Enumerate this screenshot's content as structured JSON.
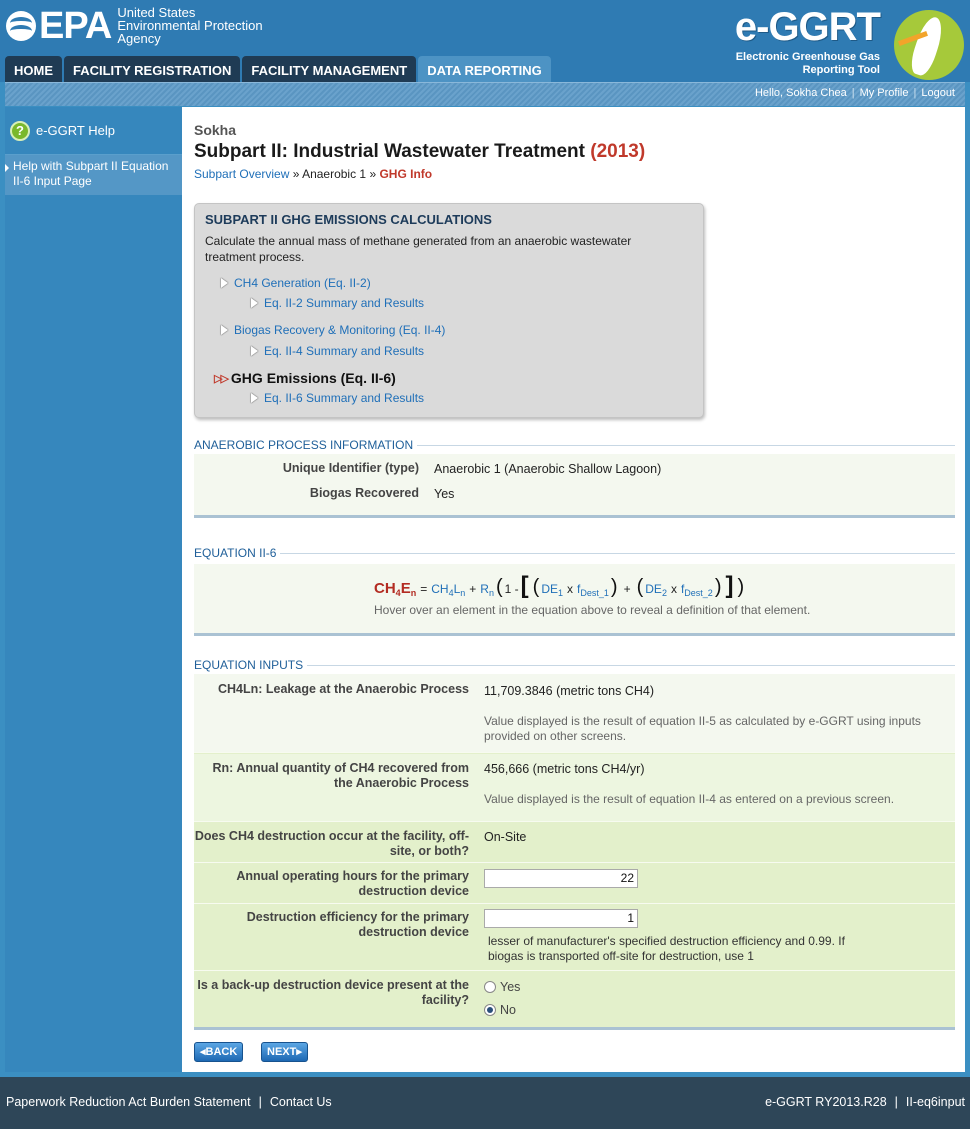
{
  "header": {
    "epa_logo_text": "EPA",
    "epa_name_lines": [
      "United States",
      "Environmental Protection",
      "Agency"
    ],
    "app_logo": "e-GGRT",
    "app_subtitle_lines": [
      "Electronic Greenhouse Gas",
      "Reporting Tool"
    ],
    "tabs": [
      {
        "label": "HOME"
      },
      {
        "label": "FACILITY REGISTRATION"
      },
      {
        "label": "FACILITY MANAGEMENT"
      },
      {
        "label": "DATA REPORTING",
        "active": true
      }
    ],
    "user_greeting": "Hello, Sokha Chea",
    "my_profile": "My Profile",
    "logout": "Logout"
  },
  "sidebar": {
    "help_title": "e-GGRT Help",
    "help_link": "Help with Subpart II Equation II-6 Input Page"
  },
  "page": {
    "facility": "Sokha",
    "title": "Subpart II: Industrial Wastewater Treatment",
    "year": "(2013)",
    "breadcrumb": {
      "overview": "Subpart Overview",
      "sep1": " » ",
      "item": "Anaerobic 1",
      "sep2": " » ",
      "current": "GHG Info"
    }
  },
  "calc_box": {
    "title": "SUBPART II GHG EMISSIONS CALCULATIONS",
    "description": "Calculate the annual mass of methane generated from an anaerobic wastewater treatment process.",
    "items": [
      {
        "label": "CH4 Generation (Eq. II-2)"
      },
      {
        "label": "Eq. II-2 Summary and Results"
      },
      {
        "label": "Biogas Recovery & Monitoring (Eq. II-4)"
      },
      {
        "label": "Eq. II-4 Summary and Results"
      },
      {
        "label": "GHG Emissions (Eq. II-6)"
      },
      {
        "label": "Eq. II-6 Summary and Results"
      }
    ]
  },
  "process_info": {
    "heading": "ANAEROBIC PROCESS INFORMATION",
    "unique_id_label": "Unique Identifier (type)",
    "unique_id_value": "Anaerobic 1 (Anaerobic Shallow Lagoon)",
    "biogas_label": "Biogas Recovered",
    "biogas_value": "Yes"
  },
  "equation": {
    "heading": "EQUATION II-6",
    "hint": "Hover over an element in the equation above to reveal a definition of that element."
  },
  "inputs": {
    "heading": "EQUATION INPUTS",
    "ch4l_label": "CH4Ln: Leakage at the Anaerobic Process",
    "ch4l_value": "11,709.3846",
    "ch4l_unit": "(metric tons CH4)",
    "ch4l_help": "Value displayed is the result of equation II-5 as calculated by e-GGRT using inputs provided on other screens.",
    "rn_label": "Rn: Annual quantity of CH4 recovered from the Anaerobic Process",
    "rn_value": "456,666",
    "rn_unit": "(metric tons CH4/yr)",
    "rn_help": "Value displayed is the result of equation II-4 as entered on a previous screen.",
    "destruction_label": "Does CH4 destruction occur at the facility, off-site, or both?",
    "destruction_value": "On-Site",
    "hours_label": "Annual operating hours for the primary destruction device",
    "hours_value": "22",
    "efficiency_label": "Destruction efficiency for the primary destruction device",
    "efficiency_value": "1",
    "efficiency_help": "lesser of manufacturer's specified destruction efficiency and 0.99. If biogas is transported off-site for destruction, use 1",
    "backup_label": "Is a back-up destruction device present at the facility?",
    "backup_options": [
      {
        "label": "Yes",
        "selected": false
      },
      {
        "label": "No",
        "selected": true
      }
    ]
  },
  "buttons": {
    "back": "BACK",
    "next": "NEXT"
  },
  "footer": {
    "paperwork": "Paperwork Reduction Act Burden Statement",
    "contact": "Contact Us",
    "version": "e-GGRT RY2013.R28",
    "page_id": "II-eq6input"
  },
  "icons": [
    "help-icon",
    "triangle-right-icon",
    "current-step-icon",
    "back-arrow-icon",
    "next-arrow-icon"
  ]
}
